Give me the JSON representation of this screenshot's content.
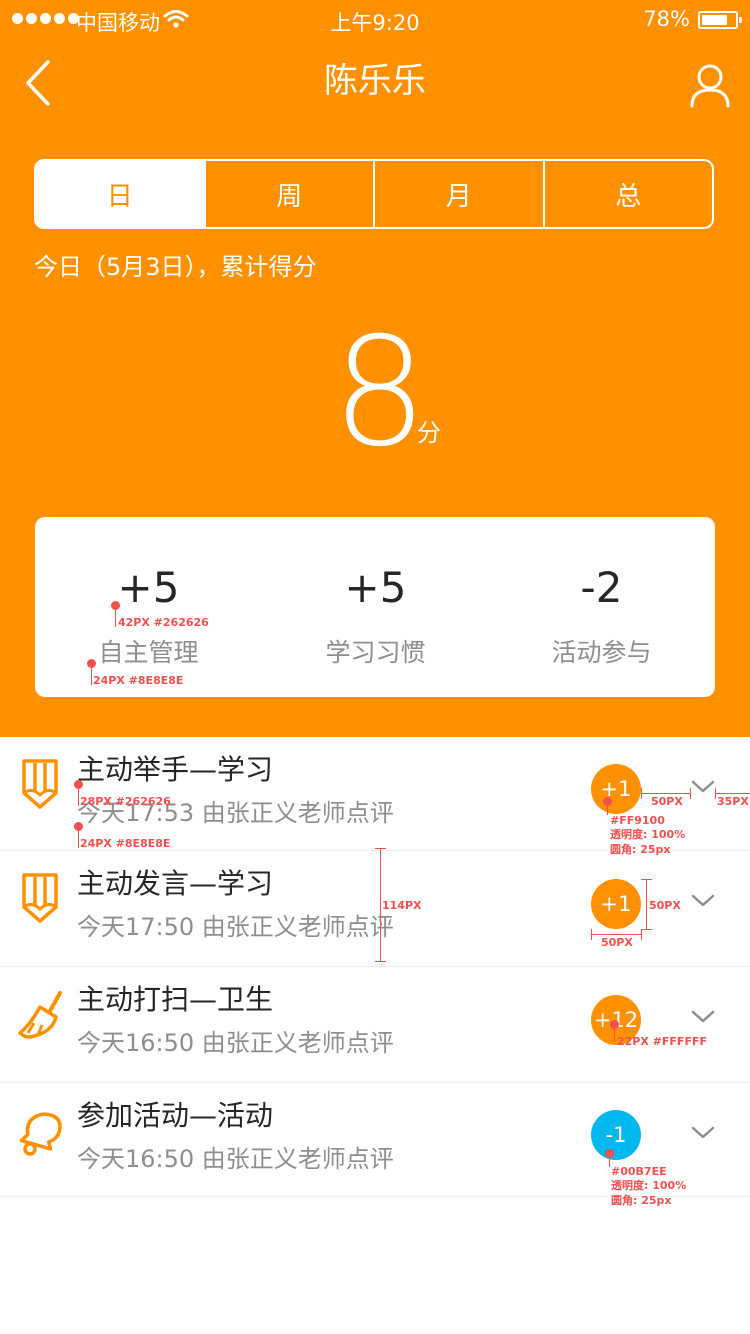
{
  "status_bar": {
    "carrier": "中国移动",
    "time": "上午9:20",
    "battery": "78%",
    "battery_level": 0.78
  },
  "nav": {
    "title": "陈乐乐"
  },
  "tabs": [
    {
      "label": "日",
      "active": true
    },
    {
      "label": "周",
      "active": false
    },
    {
      "label": "月",
      "active": false
    },
    {
      "label": "总",
      "active": false
    }
  ],
  "summary": {
    "label": "今日（5月3日），累计得分",
    "score": "8",
    "unit": "分"
  },
  "stats": [
    {
      "value": "+5",
      "label": "自主管理"
    },
    {
      "value": "+5",
      "label": "学习习惯"
    },
    {
      "value": "-2",
      "label": "活动参与"
    }
  ],
  "records": [
    {
      "icon": "pencil-icon",
      "title": "主动举手—学习",
      "subtitle": "今天17:53 由张正义老师点评",
      "score": "+1",
      "color": "#FF9100"
    },
    {
      "icon": "pencil-icon",
      "title": "主动发言—学习",
      "subtitle": "今天17:50 由张正义老师点评",
      "score": "+1",
      "color": "#FF9100"
    },
    {
      "icon": "broom-icon",
      "title": "主动打扫—卫生",
      "subtitle": "今天16:50 由张正义老师点评",
      "score": "+12",
      "color": "#FF9100"
    },
    {
      "icon": "bell-icon",
      "title": "参加活动—活动",
      "subtitle": "今天16:50 由张正义老师点评",
      "score": "-1",
      "color": "#00B7EE"
    }
  ],
  "annotations": {
    "stat_value_spec": "42PX #262626",
    "stat_label_spec": "24PX #8E8E8E",
    "title_spec": "28PX #262626",
    "subtitle_spec": "24PX #8E8E8E",
    "badge_width": "50PX",
    "chevron_margin": "35PX",
    "orange_color": "#FF9100",
    "opacity": "透明度: 100%",
    "radius": "圆角: 25px",
    "row_height": "114PX",
    "badge_height": "50PX",
    "badge_width_2": "50PX",
    "badge_text_spec": "22PX #FFFFFF",
    "blue_color": "#00B7EE",
    "opacity_2": "透明度: 100%",
    "radius_2": "圆角: 25px"
  }
}
